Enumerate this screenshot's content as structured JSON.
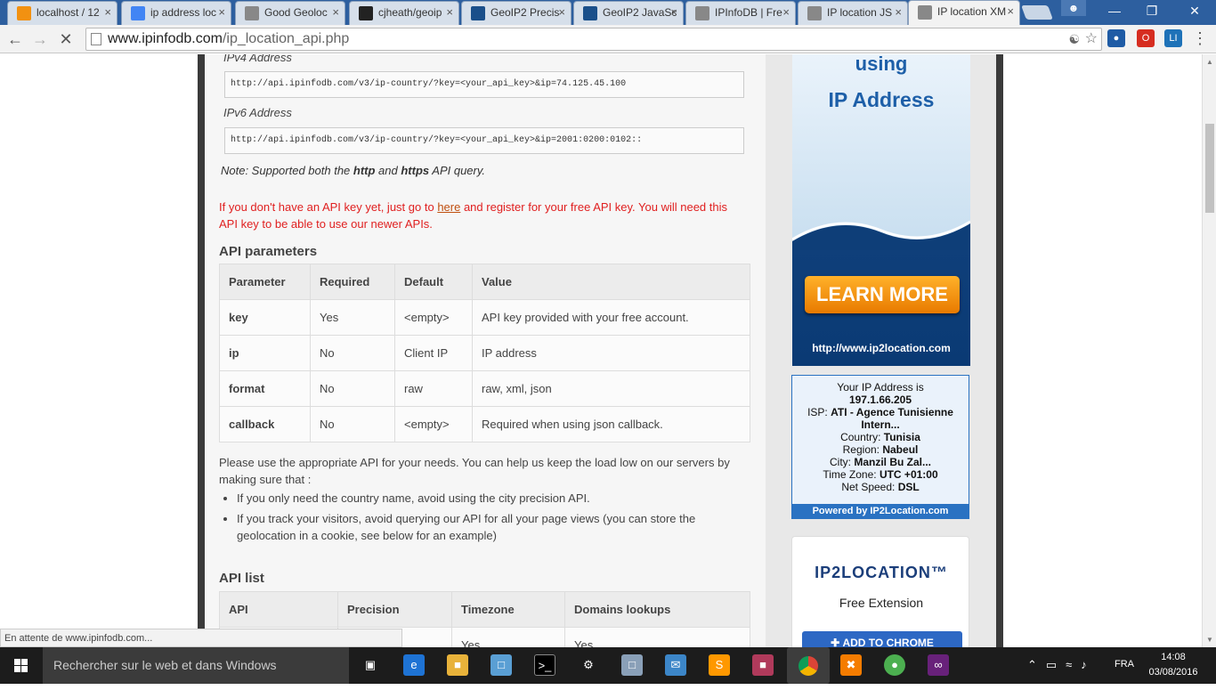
{
  "browser": {
    "tabs": [
      {
        "title": "localhost / 12",
        "icon": "phpmyadmin-icon",
        "color": "#f29111"
      },
      {
        "title": "ip address loc",
        "icon": "google-icon",
        "color": "#4285f4"
      },
      {
        "title": "Good Geoloc",
        "icon": "page-icon",
        "color": "#888888"
      },
      {
        "title": "cjheath/geoip",
        "icon": "github-icon",
        "color": "#222222"
      },
      {
        "title": "GeoIP2 Precis",
        "icon": "maxmind-icon",
        "color": "#1a4f8a"
      },
      {
        "title": "GeoIP2 JavaSc",
        "icon": "maxmind-icon",
        "color": "#1a4f8a"
      },
      {
        "title": "IPInfoDB | Fre",
        "icon": "page-icon",
        "color": "#888888"
      },
      {
        "title": "IP location JS",
        "icon": "page-icon",
        "color": "#888888"
      },
      {
        "title": "IP location XM",
        "icon": "loading-icon",
        "color": "#888888"
      }
    ],
    "profile_icon": "person-icon",
    "url_domain": "www.ipinfodb.com",
    "url_path": "/ip_location_api.php",
    "status_text": "En attente de www.ipinfodb.com..."
  },
  "page": {
    "ipv4_label": "IPv4 Address",
    "ipv4_url": "http://api.ipinfodb.com/v3/ip-country/?key=<your_api_key>&ip=74.125.45.100",
    "ipv6_label": "IPv6 Address",
    "ipv6_url": "http://api.ipinfodb.com/v3/ip-country/?key=<your_api_key>&ip=2001:0200:0102::",
    "note_prefix": "Note: Supported both the ",
    "note_http": "http",
    "note_and": " and ",
    "note_https": "https",
    "note_suffix": " API query.",
    "warn_prefix": "If you don't have an API key yet, just go to ",
    "warn_link": "here",
    "warn_suffix": " and register for your free API key. You will need this API key to be able to use our newer APIs.",
    "params_heading": "API parameters",
    "params_headers": [
      "Parameter",
      "Required",
      "Default",
      "Value"
    ],
    "params_rows": [
      [
        "key",
        "Yes",
        "<empty>",
        "API key provided with your free account."
      ],
      [
        "ip",
        "No",
        "Client IP",
        "IP address"
      ],
      [
        "format",
        "No",
        "raw",
        "raw, xml, json"
      ],
      [
        "callback",
        "No",
        "<empty>",
        "Required when using json callback."
      ]
    ],
    "usage_text": "Please use the appropriate API for your needs. You can help us keep the load low on our servers by making sure that :",
    "bullets": [
      "If you only need the country name, avoid using the city precision API.",
      "If you track your visitors, avoid querying our API for all your page views (you can store the geolocation in a cookie, see below for an example)"
    ],
    "list_heading": "API list",
    "list_headers": [
      "API",
      "Precision",
      "Timezone",
      "Domains lookups"
    ],
    "list_row_partial": [
      "",
      "",
      "Yes",
      "Yes"
    ]
  },
  "sidebar": {
    "ad_line1": "using",
    "ad_line2": "IP Address",
    "ad_button": "LEARN MORE",
    "ad_url": "http://www.ip2location.com",
    "ip_title": "Your IP Address is",
    "ip_value": "197.1.66.205",
    "isp_label": "ISP: ",
    "isp_value": "ATI - Agence Tunisienne Intern...",
    "country_label": "Country: ",
    "country_value": "Tunisia",
    "region_label": "Region: ",
    "region_value": "Nabeul",
    "city_label": "City: ",
    "city_value": "Manzil Bu Zal...",
    "tz_label": "Time Zone: ",
    "tz_value": "UTC +01:00",
    "speed_label": "Net Speed: ",
    "speed_value": "DSL",
    "powered": "Powered by IP2Location.com",
    "ext_logo": "IP2LOCATION™",
    "ext_title": "Free Extension",
    "ext_button": "ADD TO CHROME"
  },
  "taskbar": {
    "search_placeholder": "Rechercher sur le web et dans Windows",
    "lang": "FRA",
    "time": "14:08",
    "date": "03/08/2016"
  }
}
